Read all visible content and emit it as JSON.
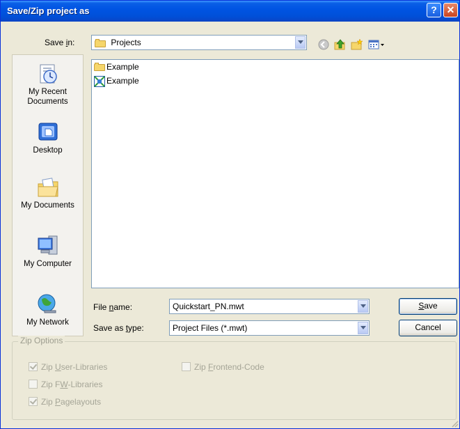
{
  "window": {
    "title": "Save/Zip project as"
  },
  "save_in": {
    "label_pre": "Save ",
    "label_u": "i",
    "label_post": "n:",
    "value": "Projects"
  },
  "toolbar": {
    "icons": [
      "back-icon",
      "up-folder-icon",
      "new-folder-icon",
      "views-menu-icon"
    ]
  },
  "places": [
    {
      "name": "my-recent-documents",
      "line1": "My Recent",
      "line2": "Documents"
    },
    {
      "name": "desktop",
      "line1": "Desktop",
      "line2": ""
    },
    {
      "name": "my-documents",
      "line1": "My Documents",
      "line2": ""
    },
    {
      "name": "my-computer",
      "line1": "My Computer",
      "line2": ""
    },
    {
      "name": "my-network",
      "line1": "My Network",
      "line2": ""
    }
  ],
  "files": [
    {
      "name": "Example",
      "icon": "folder-icon"
    },
    {
      "name": "Example",
      "icon": "project-file-icon"
    }
  ],
  "file_name": {
    "label_pre": "File ",
    "label_u": "n",
    "label_post": "ame:",
    "value": "Quickstart_PN.mwt"
  },
  "save_as_type": {
    "label_pre": "Save as ",
    "label_u": "t",
    "label_post": "ype:",
    "value": "Project Files (*.mwt)"
  },
  "buttons": {
    "save_u": "S",
    "save_rest": "ave",
    "cancel": "Cancel"
  },
  "zip_options": {
    "legend": "Zip Options",
    "user_libraries": {
      "pre": "Zip ",
      "u": "U",
      "post": "ser-Libraries",
      "checked": true
    },
    "fw_libraries": {
      "pre": "Zip F",
      "u": "W",
      "post": "-Libraries",
      "checked": false
    },
    "pagelayouts": {
      "pre": "Zip ",
      "u": "P",
      "post": "agelayouts",
      "checked": true
    },
    "frontend_code": {
      "pre": "Zip ",
      "u": "F",
      "post": "rontend-Code",
      "checked": false
    }
  }
}
